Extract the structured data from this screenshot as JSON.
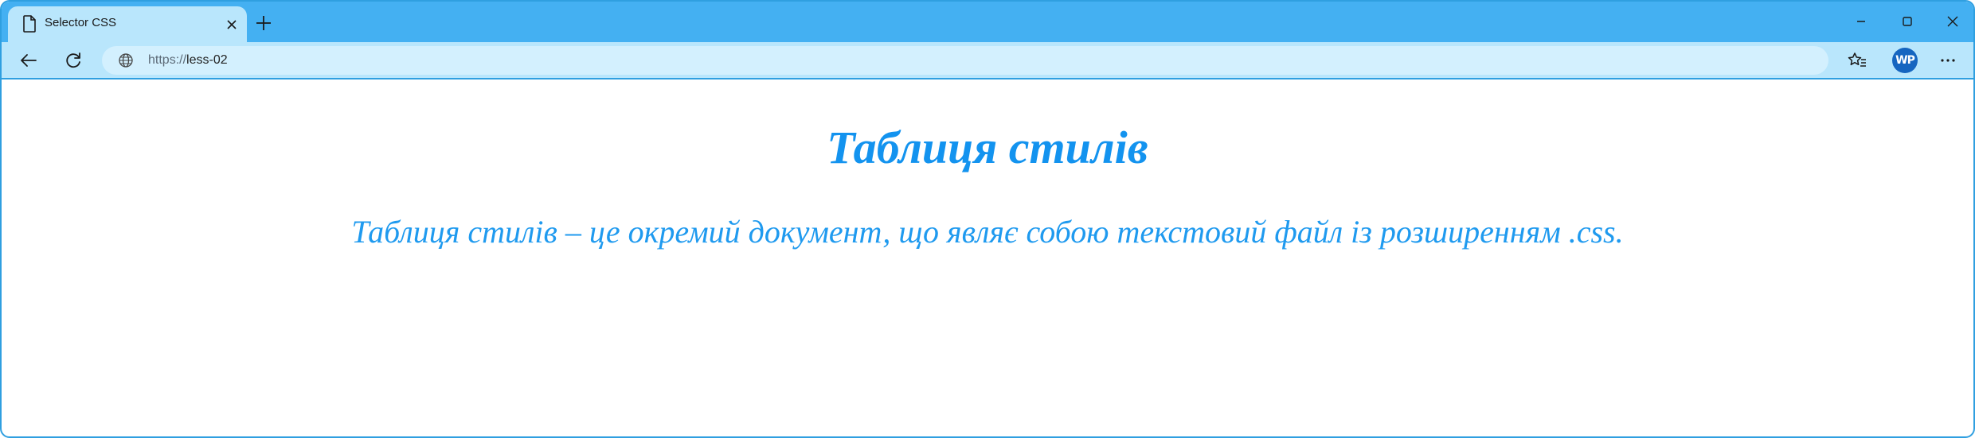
{
  "browser": {
    "tab": {
      "title": "Selector CSS",
      "icon": "page-icon",
      "close_icon": "close-icon"
    },
    "new_tab_icon": "plus-icon",
    "window_controls": [
      "minimize-icon",
      "maximize-icon",
      "close-icon"
    ],
    "toolbar": {
      "back_icon": "back-arrow-icon",
      "refresh_icon": "refresh-icon",
      "address": {
        "icon": "globe-icon",
        "protocol": "https://",
        "path": "less-02"
      },
      "favorites_icon": "favorites-icon",
      "profile_badge": "WP",
      "menu_icon": "more-icon"
    },
    "colors": {
      "tabstrip": "#44b0f2",
      "toolbar": "#b9e6fc",
      "border": "#2f9fe0",
      "heading_text": "#1393ef"
    }
  },
  "page": {
    "heading": "Таблиця стилів",
    "paragraph": "Таблиця стилів – це окремий документ, що являє собою текстовий файл із розширенням .css."
  }
}
